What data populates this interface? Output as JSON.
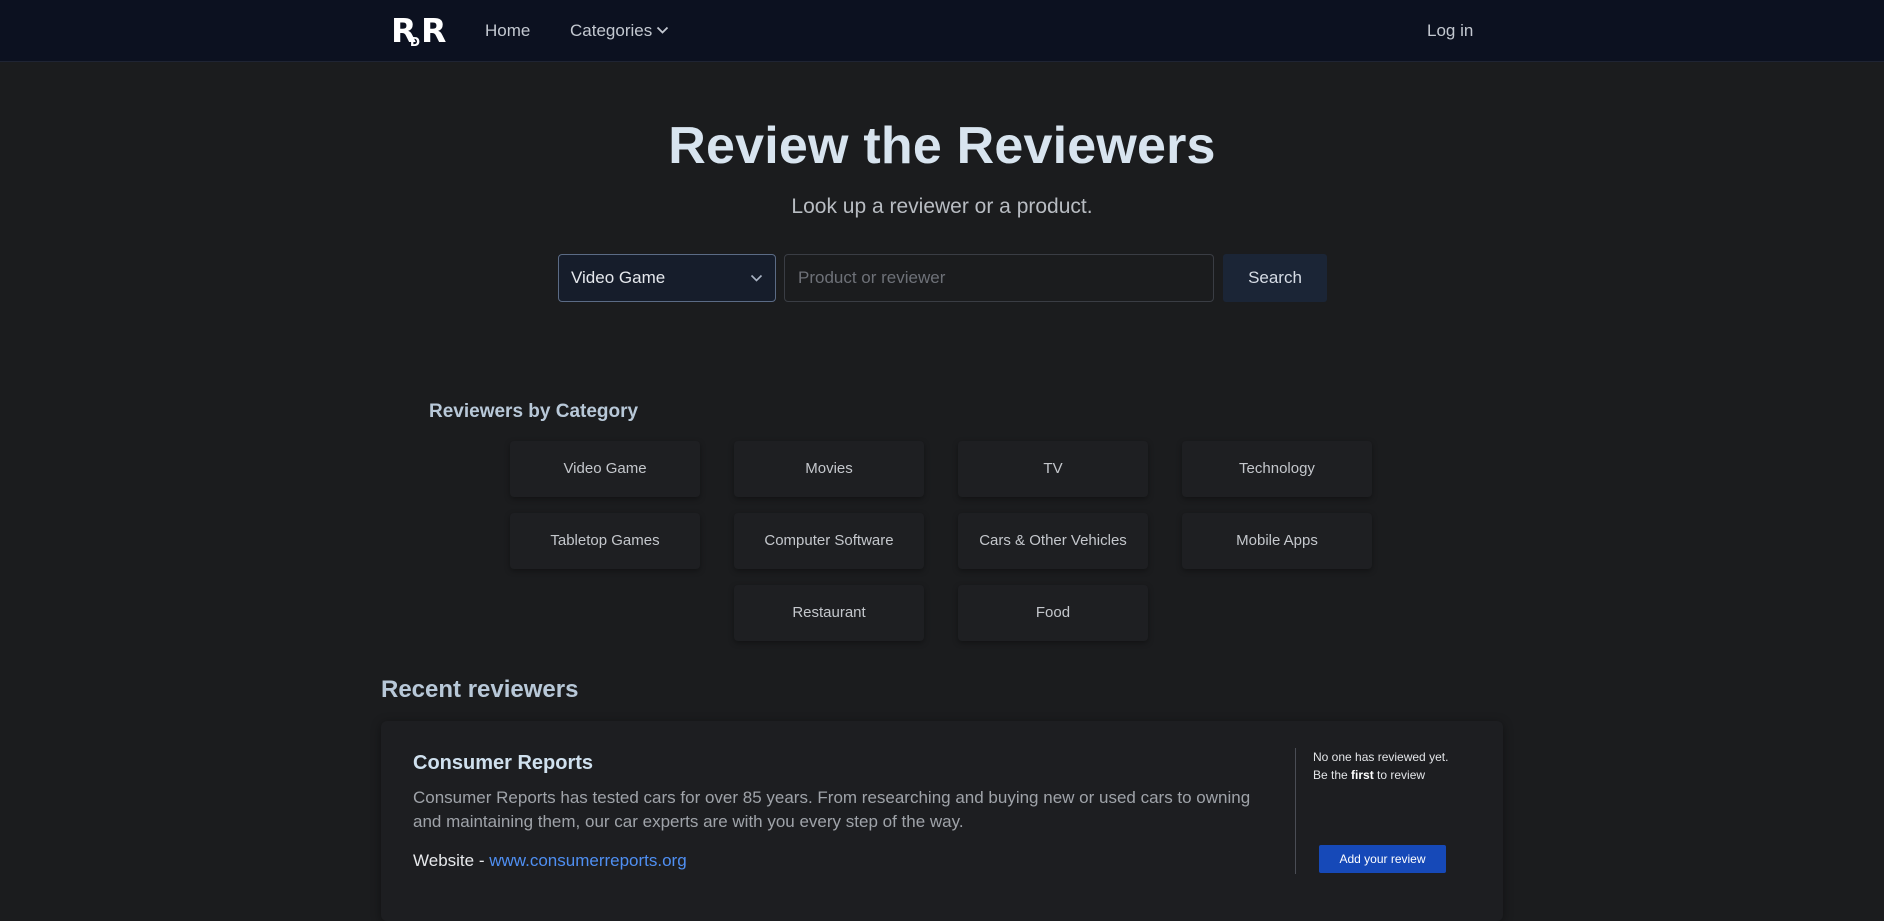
{
  "nav": {
    "logo_text": "RDR",
    "home": "Home",
    "categories": "Categories",
    "login": "Log in"
  },
  "hero": {
    "title": "Review the Reviewers",
    "subtitle": "Look up a reviewer or a product."
  },
  "search": {
    "selected_category": "Video Game",
    "placeholder": "Product or reviewer",
    "button": "Search"
  },
  "categories_section": {
    "title": "Reviewers by Category",
    "items": [
      "Video Game",
      "Movies",
      "TV",
      "Technology",
      "Tabletop Games",
      "Computer Software",
      "Cars & Other Vehicles",
      "Mobile Apps",
      "Restaurant",
      "Food"
    ]
  },
  "recent": {
    "title": "Recent reviewers",
    "reviewers": [
      {
        "name": "Consumer Reports",
        "description": "Consumer Reports has tested cars for over 85 years. From researching and buying new or used cars to owning and maintaining them, our car experts are with you every step of the way.",
        "website_label": "Website - ",
        "website": "www.consumerreports.org",
        "empty_line1": "No one has reviewed yet.",
        "empty_be": "Be the ",
        "empty_first": "first",
        "empty_to_review": " to review",
        "add_review": "Add your review"
      }
    ]
  },
  "colors": {
    "navbar_bg": "#0c1120",
    "page_bg": "#1b1c1e",
    "accent_link": "#4f8ff2",
    "primary_button": "#1649b8"
  }
}
